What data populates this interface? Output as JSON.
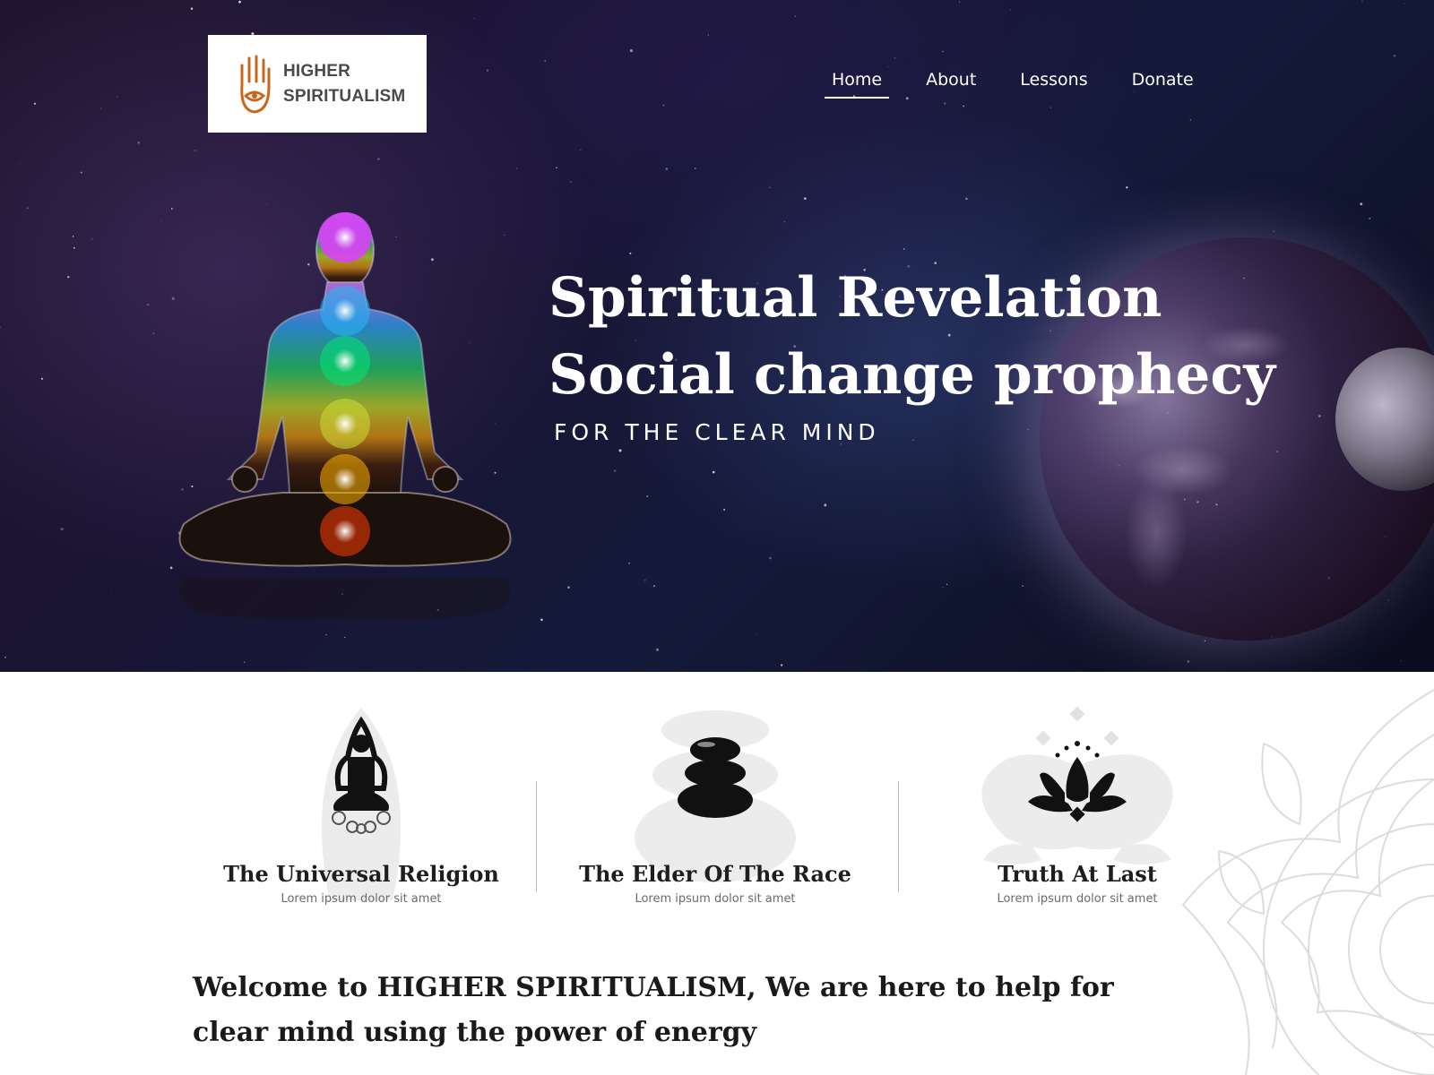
{
  "brand": {
    "line1": "HIGHER",
    "line2": "SPIRITUALISM",
    "icon": "hamsa-hand-icon",
    "icon_color": "#c8661d"
  },
  "nav": {
    "items": [
      {
        "label": "Home",
        "active": true
      },
      {
        "label": "About",
        "active": false
      },
      {
        "label": "Lessons",
        "active": false
      },
      {
        "label": "Donate",
        "active": false
      }
    ]
  },
  "hero": {
    "title_line1": "Spiritual Revelation",
    "title_line2": "Social change prophecy",
    "subtitle": "FOR THE CLEAR MIND"
  },
  "features": [
    {
      "icon": "meditation-figure-icon",
      "title": "The Universal Religion",
      "desc": "Lorem ipsum dolor sit amet"
    },
    {
      "icon": "stacked-stones-icon",
      "title": "The Elder Of  The Race",
      "desc": "Lorem ipsum dolor sit amet"
    },
    {
      "icon": "lotus-flower-icon",
      "title": "Truth At Last",
      "desc": "Lorem ipsum dolor sit amet"
    }
  ],
  "welcome": {
    "text": "Welcome to HIGHER SPIRITUALISM, We are here to help for clear mind using the power of  energy"
  },
  "colors": {
    "hero_bg": "#1a1433",
    "text_dark": "#1e1e1e",
    "chakra_colors": [
      "#e040fb",
      "#29b6f6",
      "#00e676",
      "#cddc39",
      "#ffb300",
      "#ff3d00"
    ]
  }
}
